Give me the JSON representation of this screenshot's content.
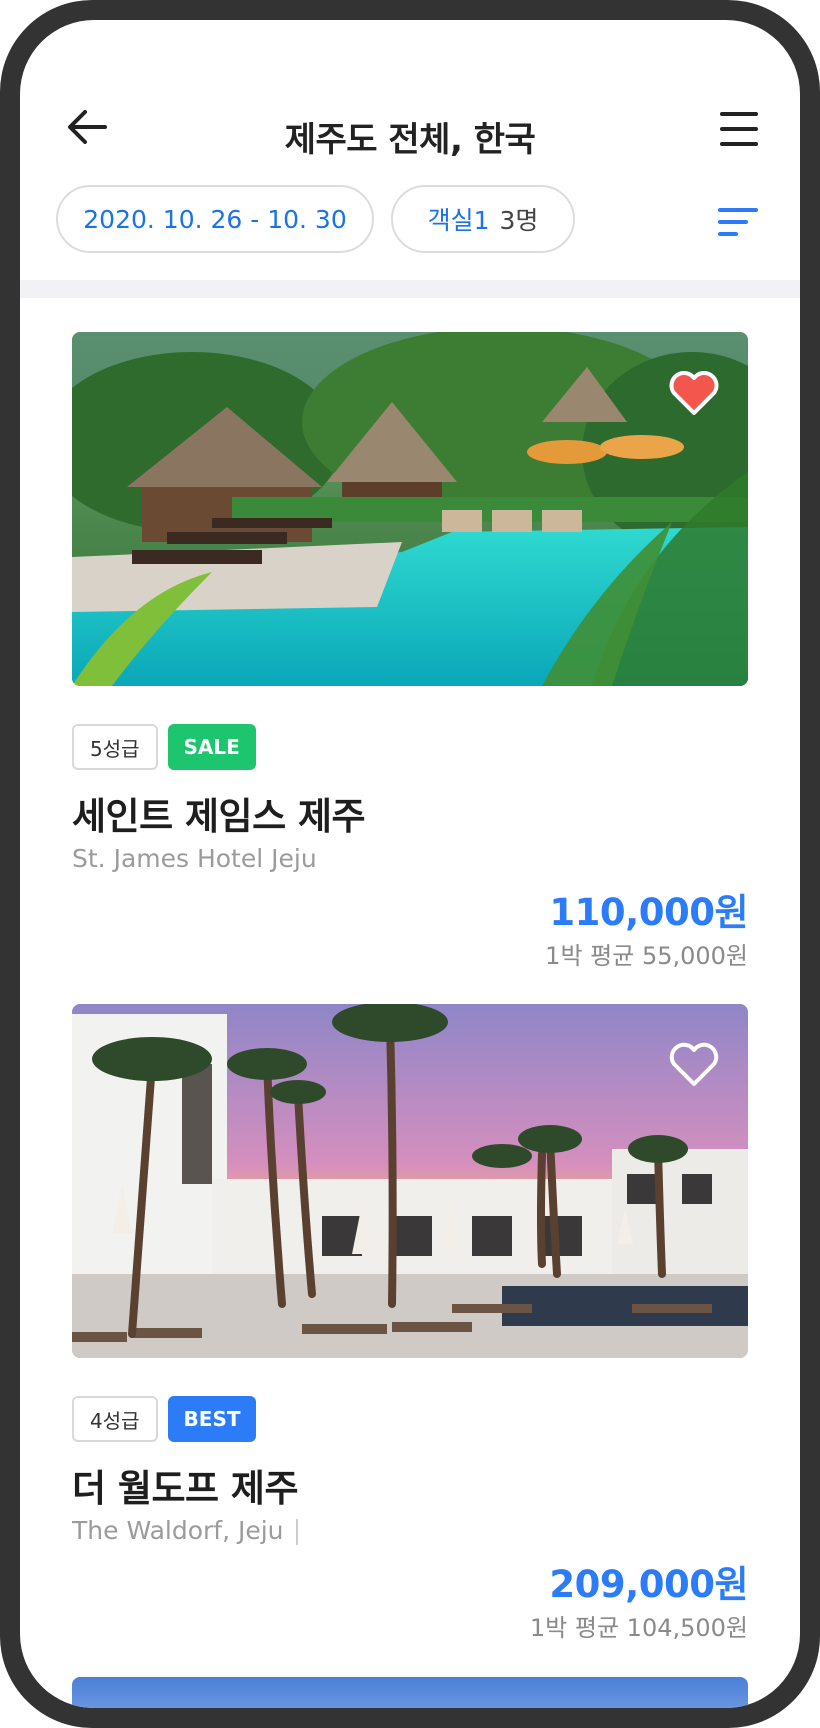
{
  "header": {
    "title": "제주도 전체, 한국"
  },
  "filters": {
    "dates": "2020. 10. 26 - 10. 30",
    "rooms": "객실1",
    "guests": "3명"
  },
  "hotels": [
    {
      "grade": "5성급",
      "tag": "SALE",
      "name": "세인트 제임스 제주",
      "name_en": "St. James Hotel Jeju",
      "price": "110,000원",
      "avg_price": "1박 평균 55,000원",
      "favorited": true
    },
    {
      "grade": "4성급",
      "tag": "BEST",
      "name": "더 월도프 제주",
      "name_en": "The Waldorf, Jeju",
      "price": "209,000원",
      "avg_price": "1박 평균 104,500원",
      "favorited": false
    }
  ],
  "colors": {
    "accent": "#2b7cf6",
    "sale": "#1cc56e",
    "heart": "#f2564d",
    "frame": "#333333"
  },
  "icons": {
    "back": "arrow-left-icon",
    "menu": "hamburger-menu-icon",
    "sort": "sort-icon",
    "favorite": "heart-icon"
  }
}
